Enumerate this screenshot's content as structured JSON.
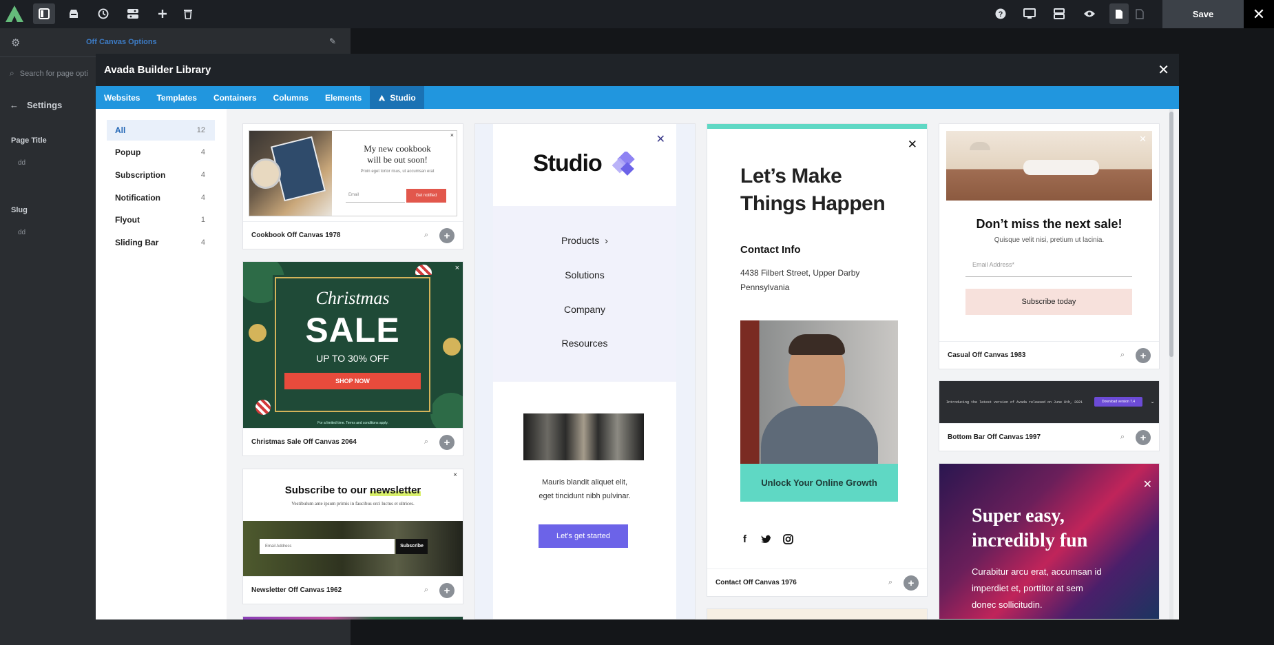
{
  "topbar": {
    "logo": "avada-logo",
    "icons": [
      "sidebar-toggle-icon",
      "library-icon",
      "history-icon",
      "layout-icon",
      "add-icon",
      "trash-icon",
      "help-icon",
      "desktop-icon",
      "structure-icon",
      "preview-icon",
      "page-icon",
      "page-outline-icon"
    ],
    "save_label": "Save",
    "close_glyph": "✕"
  },
  "sidepanel": {
    "title": "Off Canvas Options",
    "search_placeholder": "Search for page opti",
    "settings_label": "Settings",
    "page_title_label": "Page Title",
    "page_title_value": "dd",
    "slug_label": "Slug",
    "slug_value": "dd"
  },
  "modal": {
    "title": "Avada Builder Library",
    "tabs": [
      {
        "label": "Websites"
      },
      {
        "label": "Templates"
      },
      {
        "label": "Containers"
      },
      {
        "label": "Columns"
      },
      {
        "label": "Elements"
      },
      {
        "label": "Studio"
      }
    ],
    "categories": [
      {
        "label": "All",
        "count": "12"
      },
      {
        "label": "Popup",
        "count": "4"
      },
      {
        "label": "Subscription",
        "count": "4"
      },
      {
        "label": "Notification",
        "count": "4"
      },
      {
        "label": "Flyout",
        "count": "1"
      },
      {
        "label": "Sliding Bar",
        "count": "4"
      }
    ]
  },
  "cards": {
    "cookbook": {
      "label": "Cookbook Off Canvas 1978",
      "heading1": "My new cookbook",
      "heading2": "will be out soon!",
      "sub": "Proin eget tortor risus, ut accumsan erat",
      "email": "Email",
      "button": "Get notified"
    },
    "christmas": {
      "label": "Christmas Sale Off Canvas 2064",
      "script": "Christmas",
      "big": "SALE",
      "up_to": "UP TO 30% OFF",
      "button": "SHOP NOW",
      "fine": "For a limited time. Terms and conditions apply."
    },
    "newsletter": {
      "label": "Newsletter Off Canvas 1962",
      "heading_a": "Subscribe to our ",
      "heading_b": "newsletter",
      "sub": "Vestibulum ante ipsum primis in faucibus orci luctus et ultrices.",
      "email": "Email Address",
      "button": "Subscribe"
    },
    "studio": {
      "brand": "Studio",
      "menu": [
        "Products",
        "Solutions",
        "Company",
        "Resources"
      ],
      "text1": "Mauris blandit aliquet elit,",
      "text2": "eget tincidunt nibh pulvinar.",
      "button": "Let's get started"
    },
    "contact": {
      "label": "Contact Off Canvas 1976",
      "heading1": "Let’s Make",
      "heading2": "Things Happen",
      "info_title": "Contact Info",
      "addr1": "4438 Filbert Street, Upper Darby",
      "addr2": "Pennsylvania",
      "button": "Unlock Your Online Growth",
      "social": [
        "f",
        "twitter-icon",
        "instagram-icon"
      ]
    },
    "casual": {
      "label": "Casual Off Canvas 1983",
      "heading": "Don’t miss the next sale!",
      "sub": "Quisque velit nisi, pretium ut lacinia.",
      "email": "Email Address*",
      "button": "Subscribe today"
    },
    "bottombar": {
      "label": "Bottom Bar Off Canvas 1997",
      "text": "Introducing the latest version of Avada released on June 8th, 2021",
      "button": "Download version 7.4"
    },
    "supereasy": {
      "heading1": "Super easy,",
      "heading2": "incredibly fun",
      "text1": "Curabitur arcu erat, accumsan id",
      "text2": "imperdiet et, porttitor at sem",
      "text3": "donec sollicitudin."
    }
  },
  "colors": {
    "tabs": "#2196de",
    "tab_active": "#1a72b4",
    "studio_purple": "#6c63e8",
    "contact_teal": "#5fd8c4",
    "christmas_green": "#1e4a36",
    "christmas_red": "#e84b3c"
  }
}
